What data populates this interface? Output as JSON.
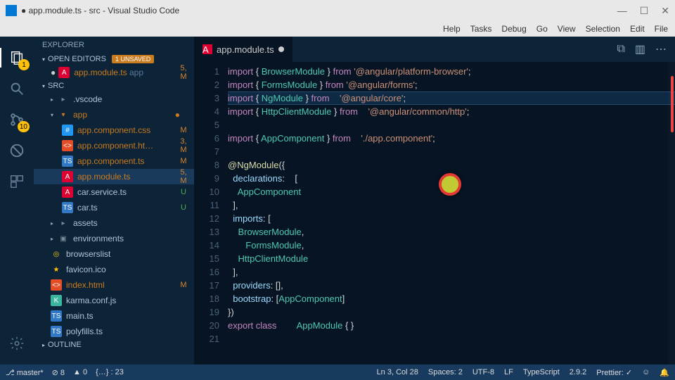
{
  "titlebar": {
    "title": "● app.module.ts - src - Visual Studio Code"
  },
  "menu": [
    "Help",
    "Tasks",
    "Debug",
    "Go",
    "View",
    "Selection",
    "Edit",
    "File"
  ],
  "activity": {
    "explorer_badge": "1",
    "scm_badge": "10"
  },
  "explorer": {
    "title": "EXPLORER",
    "open_editors": "OPEN EDITORS",
    "unsaved": "1 UNSAVED",
    "open_item": {
      "name": "app.module.ts",
      "hint": "app",
      "status": "5, M"
    },
    "root": "SRC",
    "outline": "OUTLINE",
    "tree": [
      {
        "lvl": 1,
        "icon": "folder",
        "name": ".vscode",
        "chev": "▸"
      },
      {
        "lvl": 1,
        "icon": "folder-open",
        "name": "app",
        "chev": "▾",
        "dirty": true,
        "dot": true
      },
      {
        "lvl": 2,
        "icon": "css",
        "name": "app.component.css",
        "status": "M",
        "dirty": true
      },
      {
        "lvl": 2,
        "icon": "html",
        "name": "app.component.ht…",
        "status": "3, M",
        "dirty": true
      },
      {
        "lvl": 2,
        "icon": "ts",
        "name": "app.component.ts",
        "status": "M",
        "dirty": true
      },
      {
        "lvl": 2,
        "icon": "ng",
        "name": "app.module.ts",
        "status": "5, M",
        "dirty": true,
        "selected": true
      },
      {
        "lvl": 2,
        "icon": "ng",
        "name": "car.service.ts",
        "status": "U",
        "stclass": "U"
      },
      {
        "lvl": 2,
        "icon": "ts",
        "name": "car.ts",
        "status": "U",
        "stclass": "U"
      },
      {
        "lvl": 1,
        "icon": "folder",
        "name": "assets",
        "chev": "▸"
      },
      {
        "lvl": 1,
        "icon": "env",
        "name": "environments",
        "chev": "▸"
      },
      {
        "lvl": 1,
        "icon": "chrome",
        "name": "browserslist"
      },
      {
        "lvl": 1,
        "icon": "star",
        "name": "favicon.ico"
      },
      {
        "lvl": 1,
        "icon": "html",
        "name": "index.html",
        "status": "M",
        "dirty": true
      },
      {
        "lvl": 1,
        "icon": "karma",
        "name": "karma.conf.js"
      },
      {
        "lvl": 1,
        "icon": "ts",
        "name": "main.ts"
      },
      {
        "lvl": 1,
        "icon": "ts",
        "name": "polyfills.ts"
      }
    ]
  },
  "tab": {
    "name": "app.module.ts"
  },
  "code": [
    [
      [
        "kw",
        "import"
      ],
      [
        "sym",
        " { "
      ],
      [
        "cls",
        "BrowserModule"
      ],
      [
        "sym",
        " } "
      ],
      [
        "kw",
        "from"
      ],
      [
        "sym",
        " "
      ],
      [
        "str",
        "'@angular/platform-browser'"
      ],
      [
        "sym",
        ";"
      ]
    ],
    [
      [
        "kw",
        "import"
      ],
      [
        "sym",
        " { "
      ],
      [
        "cls",
        "FormsModule"
      ],
      [
        "sym",
        " } "
      ],
      [
        "kw",
        "from"
      ],
      [
        "sym",
        " "
      ],
      [
        "str",
        "'@angular/forms'"
      ],
      [
        "sym",
        ";"
      ]
    ],
    [
      [
        "kw",
        "import"
      ],
      [
        "sym",
        " { "
      ],
      [
        "cls",
        "NgModule"
      ],
      [
        "sym",
        " } "
      ],
      [
        "kw",
        "from"
      ],
      [
        "sym",
        "    "
      ],
      [
        "str",
        "'@angular/core'"
      ],
      [
        "sym",
        ";"
      ]
    ],
    [
      [
        "kw",
        "import"
      ],
      [
        "sym",
        " { "
      ],
      [
        "cls",
        "HttpClientModule"
      ],
      [
        "sym",
        " } "
      ],
      [
        "kw",
        "from"
      ],
      [
        "sym",
        "    "
      ],
      [
        "str",
        "'@angular/common/http'"
      ],
      [
        "sym",
        ";"
      ]
    ],
    [],
    [
      [
        "kw",
        "import"
      ],
      [
        "sym",
        " { "
      ],
      [
        "cls",
        "AppComponent"
      ],
      [
        "sym",
        " } "
      ],
      [
        "kw",
        "from"
      ],
      [
        "sym",
        "    "
      ],
      [
        "str",
        "'./app.component'"
      ],
      [
        "sym",
        ";"
      ]
    ],
    [],
    [
      [
        "dec",
        "@NgModule"
      ],
      [
        "sym",
        "({"
      ]
    ],
    [
      [
        "sym",
        "  "
      ],
      [
        "key",
        "declarations"
      ],
      [
        "sym",
        ":    ["
      ]
    ],
    [
      [
        "sym",
        "    "
      ],
      [
        "cls",
        "AppComponent"
      ]
    ],
    [
      [
        "sym",
        "  ],"
      ]
    ],
    [
      [
        "sym",
        "  "
      ],
      [
        "key",
        "imports"
      ],
      [
        "sym",
        ": ["
      ]
    ],
    [
      [
        "sym",
        "    "
      ],
      [
        "cls",
        "BrowserModule"
      ],
      [
        "sym",
        ","
      ]
    ],
    [
      [
        "sym",
        "       "
      ],
      [
        "cls",
        "FormsModule"
      ],
      [
        "sym",
        ","
      ]
    ],
    [
      [
        "sym",
        "    "
      ],
      [
        "cls",
        "HttpClientModule"
      ]
    ],
    [
      [
        "sym",
        "  ],"
      ]
    ],
    [
      [
        "sym",
        "  "
      ],
      [
        "key",
        "providers"
      ],
      [
        "sym",
        ": [],"
      ]
    ],
    [
      [
        "sym",
        "  "
      ],
      [
        "key",
        "bootstrap"
      ],
      [
        "sym",
        ": ["
      ],
      [
        "cls",
        "AppComponent"
      ],
      [
        "sym",
        "]"
      ]
    ],
    [
      [
        "sym",
        "})"
      ]
    ],
    [
      [
        "kw",
        "export"
      ],
      [
        "sym",
        " "
      ],
      [
        "kw",
        "class"
      ],
      [
        "sym",
        "        "
      ],
      [
        "cls",
        "AppModule"
      ],
      [
        "sym",
        " { }"
      ]
    ],
    []
  ],
  "status": {
    "branch": "master*",
    "errors": "⊘ 8",
    "warnings": "▲ 0",
    "info": "{…} : 23",
    "pos": "Ln 3, Col 28",
    "spaces": "Spaces: 2",
    "enc": "UTF-8",
    "eol": "LF",
    "lang": "TypeScript",
    "ver": "2.9.2",
    "prettier": "Prettier: ✓",
    "smile": "☺",
    "bell": "🔔"
  }
}
